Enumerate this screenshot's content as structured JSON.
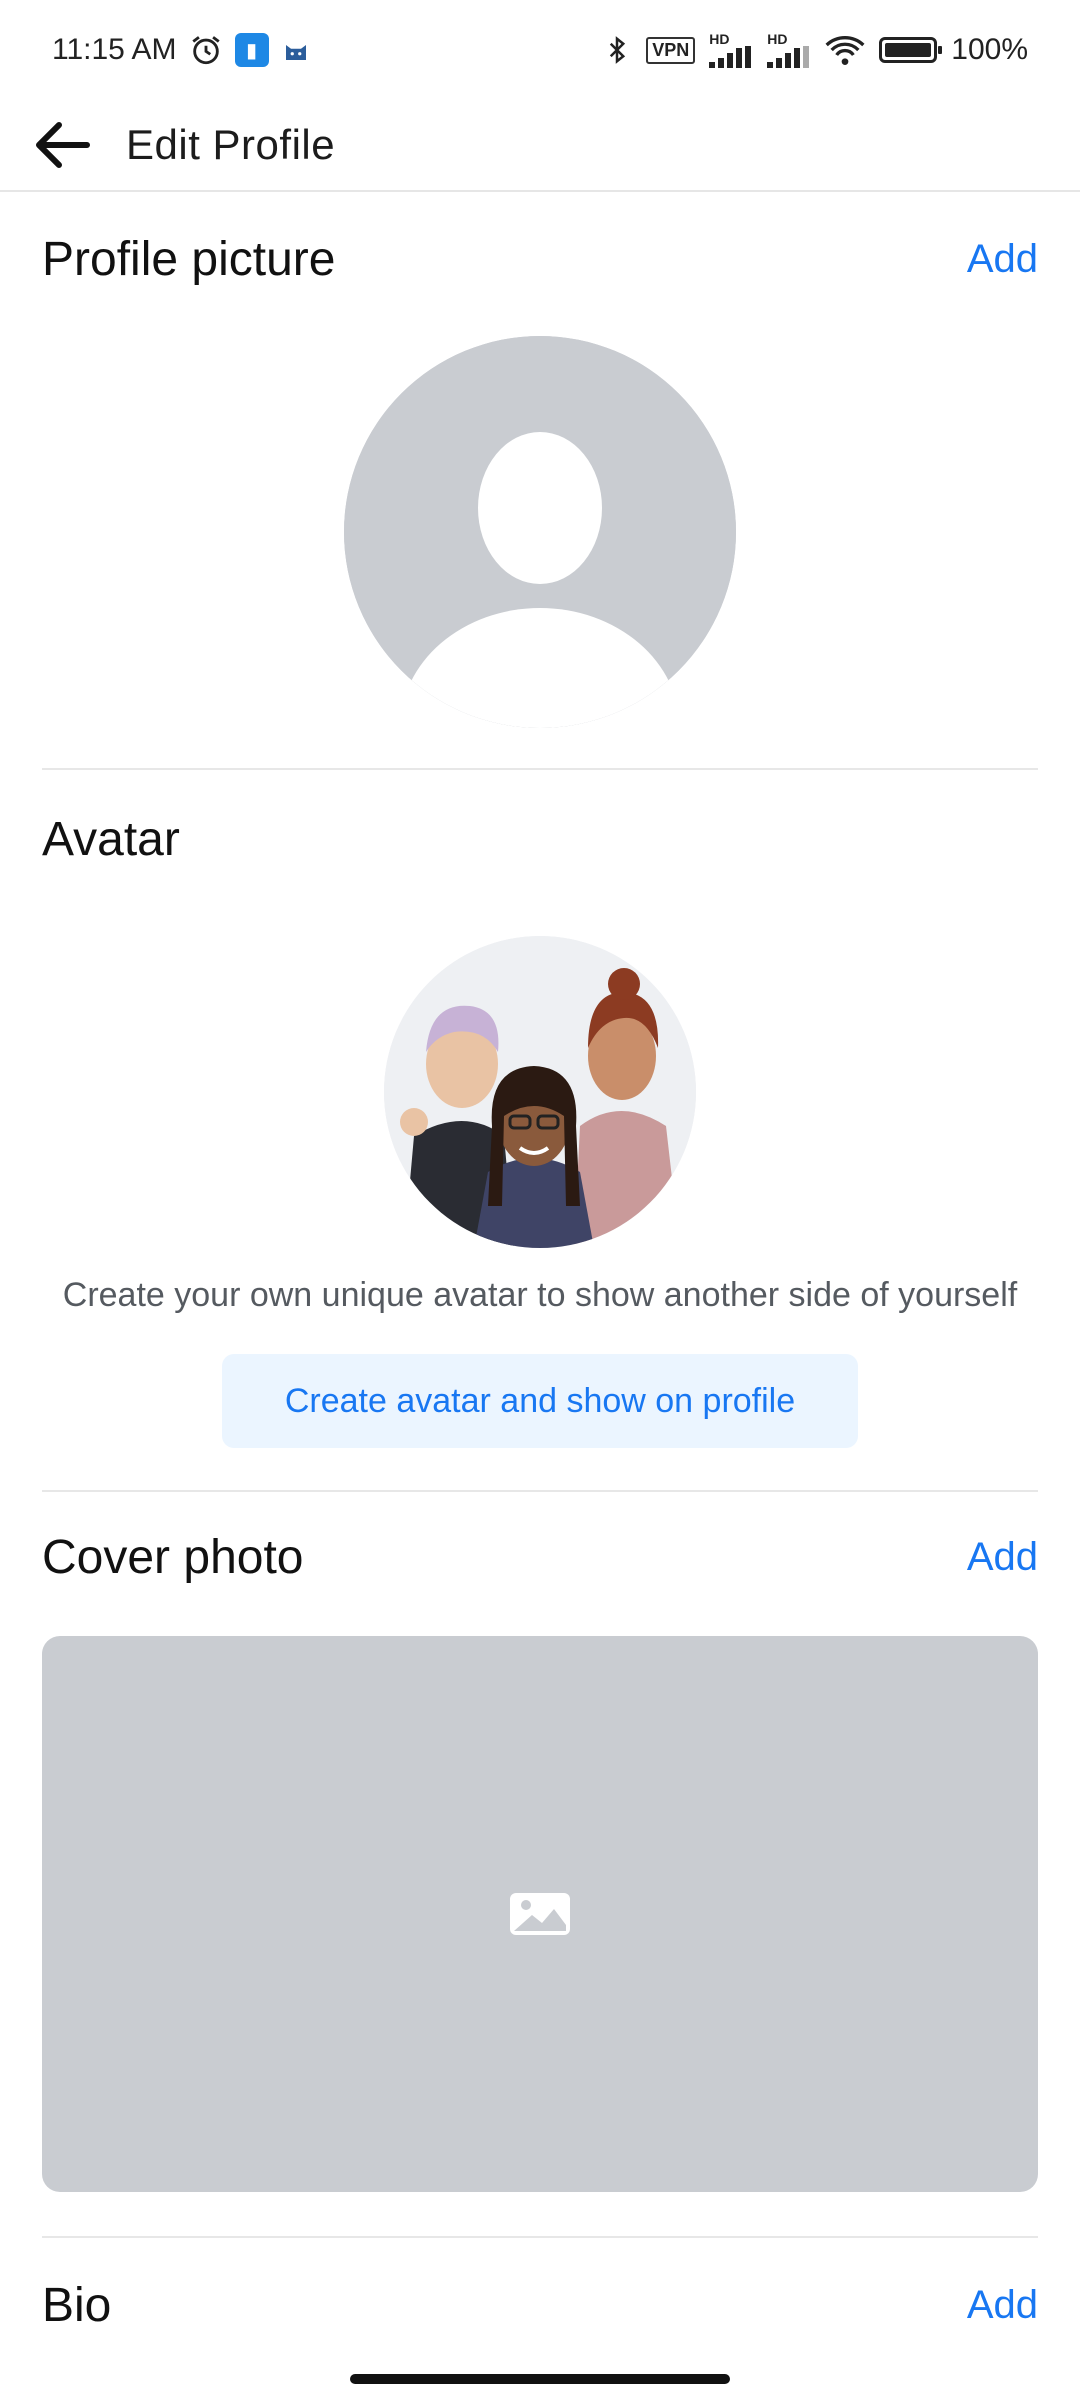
{
  "status_bar": {
    "time": "11:15 AM",
    "vpn": "VPN",
    "hd1": "HD",
    "hd2": "HD",
    "battery_text": "100%",
    "battery_level": 1.0,
    "icons": [
      "alarm-icon",
      "app-notification-icon",
      "cat-icon",
      "bluetooth-icon",
      "vpn-icon",
      "signal-icon",
      "wifi-icon",
      "battery-icon"
    ]
  },
  "header": {
    "title": "Edit Profile",
    "back_icon": "arrow-left-icon"
  },
  "profile_picture": {
    "title": "Profile picture",
    "action": "Add",
    "placeholder_icon": "default-avatar-icon"
  },
  "avatar": {
    "title": "Avatar",
    "caption": "Create your own unique avatar to show another side of yourself",
    "button": "Create avatar and show on profile"
  },
  "cover_photo": {
    "title": "Cover photo",
    "action": "Add",
    "placeholder_icon": "image-icon"
  },
  "bio": {
    "title": "Bio",
    "action": "Add"
  },
  "colors": {
    "accent": "#1877f2",
    "placeholder_gray": "#c9ccd1",
    "button_bg": "#ebf5ff"
  }
}
